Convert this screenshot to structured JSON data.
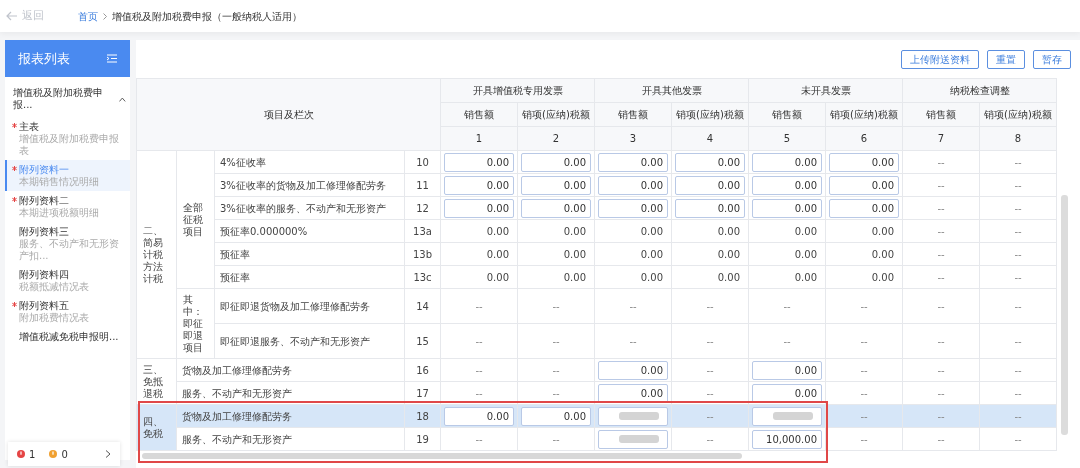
{
  "topbar": {
    "back": {
      "label": "返回",
      "disabled": true
    },
    "breadcrumb": [
      {
        "label": "首页",
        "link": true
      },
      {
        "label": "增值税及附加税费申报（一般纳税人适用）",
        "link": false
      }
    ]
  },
  "sidebar": {
    "title": "报表列表",
    "group": {
      "label": "增值税及附加税费申报...",
      "expanded": true
    },
    "items": [
      {
        "title": "主表",
        "subtitle": "增值税及附加税费申报表",
        "required": true,
        "selected": false
      },
      {
        "title": "附列资料一",
        "subtitle": "本期销售情况明细",
        "required": true,
        "selected": true
      },
      {
        "title": "附列资料二",
        "subtitle": "本期进项税额明细",
        "required": true,
        "selected": false
      },
      {
        "title": "附列资料三",
        "subtitle": "服务、不动产和无形资产扣...",
        "required": false,
        "selected": false
      },
      {
        "title": "附列资料四",
        "subtitle": "税额抵减情况表",
        "required": false,
        "selected": false
      },
      {
        "title": "附列资料五",
        "subtitle": "附加税费情况表",
        "required": true,
        "selected": false
      },
      {
        "title": "增值税减免税申报明...",
        "required": false,
        "selected": false
      }
    ],
    "status": {
      "errors": "1",
      "warnings": "0"
    }
  },
  "buttons": [
    "上传附送资料",
    "重置",
    "暂存"
  ],
  "table": {
    "item_header": "项目及栏次",
    "groups": [
      {
        "label": "开具增值税专用发票",
        "columns": [
          {
            "label": "销售额",
            "number": "1"
          },
          {
            "label": "销项(应纳)税额",
            "number": "2"
          }
        ]
      },
      {
        "label": "开具其他发票",
        "columns": [
          {
            "label": "销售额",
            "number": "3"
          },
          {
            "label": "销项(应纳)税额",
            "number": "4"
          }
        ]
      },
      {
        "label": "未开具发票",
        "columns": [
          {
            "label": "销售额",
            "number": "5"
          },
          {
            "label": "销项(应纳)税额",
            "number": "6"
          }
        ]
      },
      {
        "label": "纳税检查调整",
        "columns": [
          {
            "label": "销售额",
            "number": "7"
          },
          {
            "label": "销项(应纳)税额",
            "number": "8"
          }
        ]
      }
    ],
    "sections": [
      {
        "label": "二、简易计税方法计税",
        "subsections": [
          {
            "label": "全部征税项目",
            "rows": [
              {
                "item": "4%征收率",
                "no": "10",
                "selected": false,
                "cells": [
                  {
                    "kind": "input",
                    "value": "0.00"
                  },
                  {
                    "kind": "input",
                    "value": "0.00"
                  },
                  {
                    "kind": "input",
                    "value": "0.00"
                  },
                  {
                    "kind": "input",
                    "value": "0.00"
                  },
                  {
                    "kind": "input",
                    "value": "0.00"
                  },
                  {
                    "kind": "input",
                    "value": "0.00"
                  },
                  {
                    "kind": "text",
                    "value": "--"
                  },
                  {
                    "kind": "text",
                    "value": "--"
                  }
                ]
              },
              {
                "item": "3%征收率的货物及加工修理修配劳务",
                "no": "11",
                "selected": false,
                "cells": [
                  {
                    "kind": "input",
                    "value": "0.00"
                  },
                  {
                    "kind": "input",
                    "value": "0.00"
                  },
                  {
                    "kind": "input",
                    "value": "0.00"
                  },
                  {
                    "kind": "input",
                    "value": "0.00"
                  },
                  {
                    "kind": "input",
                    "value": "0.00"
                  },
                  {
                    "kind": "input",
                    "value": "0.00"
                  },
                  {
                    "kind": "text",
                    "value": "--"
                  },
                  {
                    "kind": "text",
                    "value": "--"
                  }
                ]
              },
              {
                "item": "3%征收率的服务、不动产和无形资产",
                "no": "12",
                "selected": false,
                "cells": [
                  {
                    "kind": "input",
                    "value": "0.00"
                  },
                  {
                    "kind": "input",
                    "value": "0.00"
                  },
                  {
                    "kind": "input",
                    "value": "0.00"
                  },
                  {
                    "kind": "input",
                    "value": "0.00"
                  },
                  {
                    "kind": "input",
                    "value": "0.00"
                  },
                  {
                    "kind": "input",
                    "value": "0.00"
                  },
                  {
                    "kind": "text",
                    "value": "--"
                  },
                  {
                    "kind": "text",
                    "value": "--"
                  }
                ]
              },
              {
                "item": "预征率0.000000%",
                "no": "13a",
                "selected": false,
                "cells": [
                  {
                    "kind": "text",
                    "value": "0.00"
                  },
                  {
                    "kind": "text",
                    "value": "0.00"
                  },
                  {
                    "kind": "text",
                    "value": "0.00"
                  },
                  {
                    "kind": "text",
                    "value": "0.00"
                  },
                  {
                    "kind": "text",
                    "value": "0.00"
                  },
                  {
                    "kind": "text",
                    "value": "0.00"
                  },
                  {
                    "kind": "text",
                    "value": "--"
                  },
                  {
                    "kind": "text",
                    "value": "--"
                  }
                ]
              },
              {
                "item": "预征率",
                "no": "13b",
                "selected": false,
                "cells": [
                  {
                    "kind": "text",
                    "value": "0.00"
                  },
                  {
                    "kind": "text",
                    "value": "0.00"
                  },
                  {
                    "kind": "text",
                    "value": "0.00"
                  },
                  {
                    "kind": "text",
                    "value": "0.00"
                  },
                  {
                    "kind": "text",
                    "value": "0.00"
                  },
                  {
                    "kind": "text",
                    "value": "0.00"
                  },
                  {
                    "kind": "text",
                    "value": "--"
                  },
                  {
                    "kind": "text",
                    "value": "--"
                  }
                ]
              },
              {
                "item": "预征率",
                "no": "13c",
                "selected": false,
                "cells": [
                  {
                    "kind": "text",
                    "value": "0.00"
                  },
                  {
                    "kind": "text",
                    "value": "0.00"
                  },
                  {
                    "kind": "text",
                    "value": "0.00"
                  },
                  {
                    "kind": "text",
                    "value": "0.00"
                  },
                  {
                    "kind": "text",
                    "value": "0.00"
                  },
                  {
                    "kind": "text",
                    "value": "0.00"
                  },
                  {
                    "kind": "text",
                    "value": "--"
                  },
                  {
                    "kind": "text",
                    "value": "--"
                  }
                ]
              }
            ]
          },
          {
            "label": "其中：即征即退项目",
            "rows": [
              {
                "item": "即征即退货物及加工修理修配劳务",
                "no": "14",
                "selected": false,
                "cells": [
                  {
                    "kind": "text",
                    "value": "--"
                  },
                  {
                    "kind": "text",
                    "value": "--"
                  },
                  {
                    "kind": "text",
                    "value": "--"
                  },
                  {
                    "kind": "text",
                    "value": "--"
                  },
                  {
                    "kind": "text",
                    "value": "--"
                  },
                  {
                    "kind": "text",
                    "value": "--"
                  },
                  {
                    "kind": "text",
                    "value": "--"
                  },
                  {
                    "kind": "text",
                    "value": "--"
                  }
                ]
              },
              {
                "item": "即征即退服务、不动产和无形资产",
                "no": "15",
                "selected": false,
                "cells": [
                  {
                    "kind": "text",
                    "value": "--"
                  },
                  {
                    "kind": "text",
                    "value": "--"
                  },
                  {
                    "kind": "text",
                    "value": "--"
                  },
                  {
                    "kind": "text",
                    "value": "--"
                  },
                  {
                    "kind": "text",
                    "value": "--"
                  },
                  {
                    "kind": "text",
                    "value": "--"
                  },
                  {
                    "kind": "text",
                    "value": "--"
                  },
                  {
                    "kind": "text",
                    "value": "--"
                  }
                ]
              }
            ]
          }
        ]
      },
      {
        "label": "三、免抵退税",
        "rows": [
          {
            "item": "货物及加工修理修配劳务",
            "no": "16",
            "selected": false,
            "cells": [
              {
                "kind": "text",
                "value": "--"
              },
              {
                "kind": "text",
                "value": "--"
              },
              {
                "kind": "input",
                "value": "0.00"
              },
              {
                "kind": "text",
                "value": "--"
              },
              {
                "kind": "input",
                "value": "0.00"
              },
              {
                "kind": "text",
                "value": "--"
              },
              {
                "kind": "text",
                "value": "--"
              },
              {
                "kind": "text",
                "value": "--"
              }
            ]
          },
          {
            "item": "服务、不动产和无形资产",
            "no": "17",
            "selected": false,
            "cells": [
              {
                "kind": "text",
                "value": "--"
              },
              {
                "kind": "text",
                "value": "--"
              },
              {
                "kind": "input",
                "value": "0.00"
              },
              {
                "kind": "text",
                "value": "--"
              },
              {
                "kind": "input",
                "value": "0.00"
              },
              {
                "kind": "text",
                "value": "--"
              },
              {
                "kind": "text",
                "value": "--"
              },
              {
                "kind": "text",
                "value": "--"
              }
            ]
          }
        ]
      },
      {
        "label": "四、免税",
        "rows": [
          {
            "item": "货物及加工修理修配劳务",
            "no": "18",
            "selected": true,
            "cells": [
              {
                "kind": "input",
                "value": "0.00"
              },
              {
                "kind": "input",
                "value": "0.00"
              },
              {
                "kind": "masked"
              },
              {
                "kind": "text",
                "value": "--"
              },
              {
                "kind": "masked"
              },
              {
                "kind": "text",
                "value": "--"
              },
              {
                "kind": "text",
                "value": "--"
              },
              {
                "kind": "text",
                "value": "--"
              }
            ]
          },
          {
            "item": "服务、不动产和无形资产",
            "no": "19",
            "selected": false,
            "cells": [
              {
                "kind": "text",
                "value": "--"
              },
              {
                "kind": "text",
                "value": "--"
              },
              {
                "kind": "masked"
              },
              {
                "kind": "text",
                "value": "--"
              },
              {
                "kind": "input",
                "value": "10,000.00"
              },
              {
                "kind": "text",
                "value": "--"
              },
              {
                "kind": "text",
                "value": "--"
              },
              {
                "kind": "text",
                "value": "--"
              }
            ]
          }
        ]
      }
    ]
  },
  "annotation_frame": true
}
